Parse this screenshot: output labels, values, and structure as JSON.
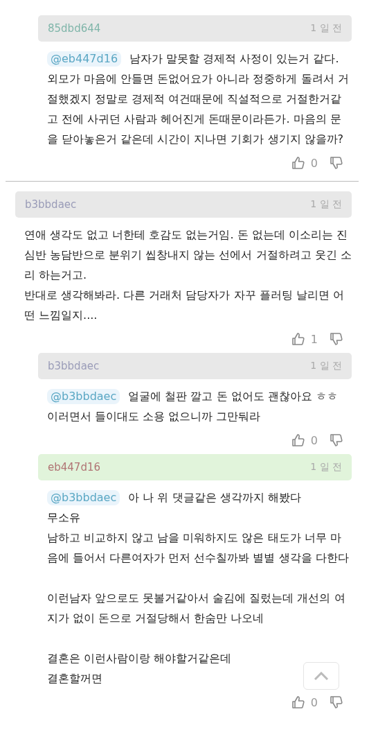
{
  "comments": [
    {
      "kind": "reply",
      "author": "85dbd644",
      "color": "#7fb5a9",
      "time": "1 일 전",
      "highlighted": false,
      "mention": "@eb447d16",
      "blocks": [
        [
          "남자가 말못할 경제적 사정이 있는거 같다.",
          "외모가 마음에 안들면 돈없어요가 아니라 정중하게 돌려서 거절했겠지 정말로 경제적 여건때문에 직설적으로 거절한거같고 전에 사귀던 사람과 헤어진게 돈때문이라든가. 마음의 문을 닫아놓은거 같은데 시간이 지나면 기회가 생기지 않을까?"
        ]
      ],
      "likes": "0"
    },
    {
      "kind": "comment",
      "author": "b3bbdaec",
      "color": "#9a9cb8",
      "time": "1 일 전",
      "highlighted": false,
      "blocks": [
        [
          "연애 생각도 없고 너한테 호감도 없는거임. 돈 없는데 이소리는 진심반 농담반으로 분위기 씹창내지 않는 선에서 거절하려고 웃긴 소리 하는거고.",
          "반대로 생각해봐라. 다른 거래처 담당자가 자꾸 플러팅 날리면 어떤 느낌일지...."
        ]
      ],
      "likes": "1",
      "children": [
        {
          "kind": "reply",
          "author": "b3bbdaec",
          "color": "#9a9cb8",
          "time": "1 일 전",
          "highlighted": false,
          "mention": "@b3bbdaec",
          "blocks": [
            [
              "얼굴에 철판 깔고 돈 없어도 괜찮아요 ㅎㅎ",
              "이러면서 들이대도 소용 없으니까 그만둬라"
            ]
          ],
          "likes": "0"
        },
        {
          "kind": "reply",
          "author": "eb447d16",
          "color": "#b07474",
          "time": "1 일 전",
          "highlighted": true,
          "mention": "@b3bbdaec",
          "blocks": [
            [
              "아 나 위 댓글같은 생각까지 해봤다",
              "무소유",
              "남하고 비교하지 않고 남을 미워하지도 않은 태도가 너무 마음에 들어서 다른여자가 먼저 선수칠까봐 별별 생각을 다한다"
            ],
            [
              "이런남자 앞으로도 못볼거같아서 술김에 질렀는데 개선의 여지가 없이 돈으로 거절당해서 한숨만 나오네"
            ],
            [
              "결혼은 이런사람이랑 해야할거같은데",
              "결혼할꺼면"
            ]
          ],
          "likes": "0"
        }
      ]
    }
  ]
}
